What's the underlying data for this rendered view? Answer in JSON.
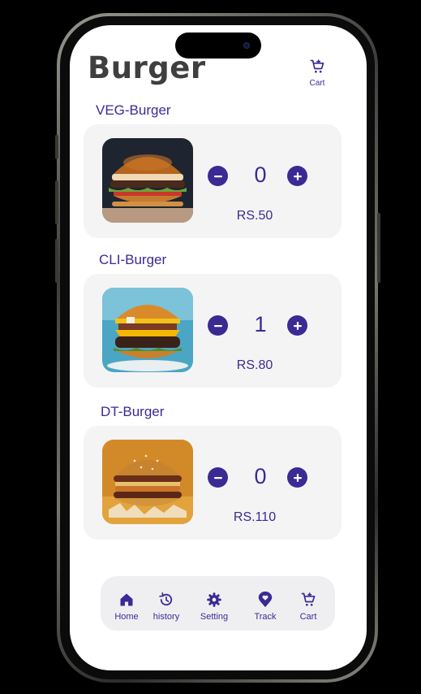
{
  "header": {
    "title": "Burger",
    "cart_label": "Cart"
  },
  "items": [
    {
      "name": "VEG-Burger",
      "quantity": "0",
      "price": "RS.50"
    },
    {
      "name": "CLI-Burger",
      "quantity": "1",
      "price": "RS.80"
    },
    {
      "name": "DT-Burger",
      "quantity": "0",
      "price": "RS.110"
    }
  ],
  "bottom_nav": [
    {
      "label": "Home",
      "icon": "home-icon"
    },
    {
      "label": "history",
      "icon": "history-icon"
    },
    {
      "label": "Setting",
      "icon": "gear-icon"
    },
    {
      "label": "Track",
      "icon": "location-pin-icon"
    },
    {
      "label": "Cart",
      "icon": "cart-icon"
    }
  ],
  "colors": {
    "accent": "#3b2a94",
    "card_bg": "#f4f4f4",
    "nav_bg": "#efeff2",
    "title": "#3f3f3f"
  }
}
